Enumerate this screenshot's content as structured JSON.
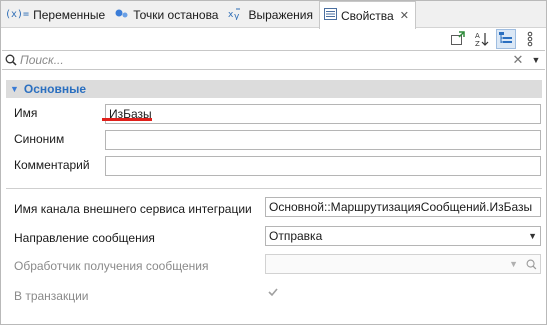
{
  "tabs": [
    {
      "icon": "variables-icon",
      "glyph": "(x)=",
      "label": "Переменные"
    },
    {
      "icon": "breakpoints-icon",
      "glyph": "●",
      "label": "Точки останова"
    },
    {
      "icon": "expressions-icon",
      "glyph": "✦",
      "label": "Выражения"
    },
    {
      "icon": "properties-icon",
      "glyph": "▤",
      "label": "Свойства",
      "active": true
    }
  ],
  "search": {
    "placeholder": "Поиск..."
  },
  "section": {
    "title": "Основные"
  },
  "fields": {
    "name_label": "Имя",
    "name_value": "ИзБазы",
    "synonym_label": "Синоним",
    "synonym_value": "",
    "comment_label": "Комментарий",
    "comment_value": "",
    "channel_label": "Имя канала внешнего сервиса интеграции",
    "channel_value": "Основной::МаршрутизацияСообщений.ИзБазы",
    "direction_label": "Направление сообщения",
    "direction_value": "Отправка",
    "handler_label": "Обработчик получения сообщения",
    "handler_value": "",
    "transaction_label": "В транзакции",
    "transaction_checked": true
  },
  "colors": {
    "accent": "#2a6fc0",
    "highlight": "#e0201b"
  }
}
